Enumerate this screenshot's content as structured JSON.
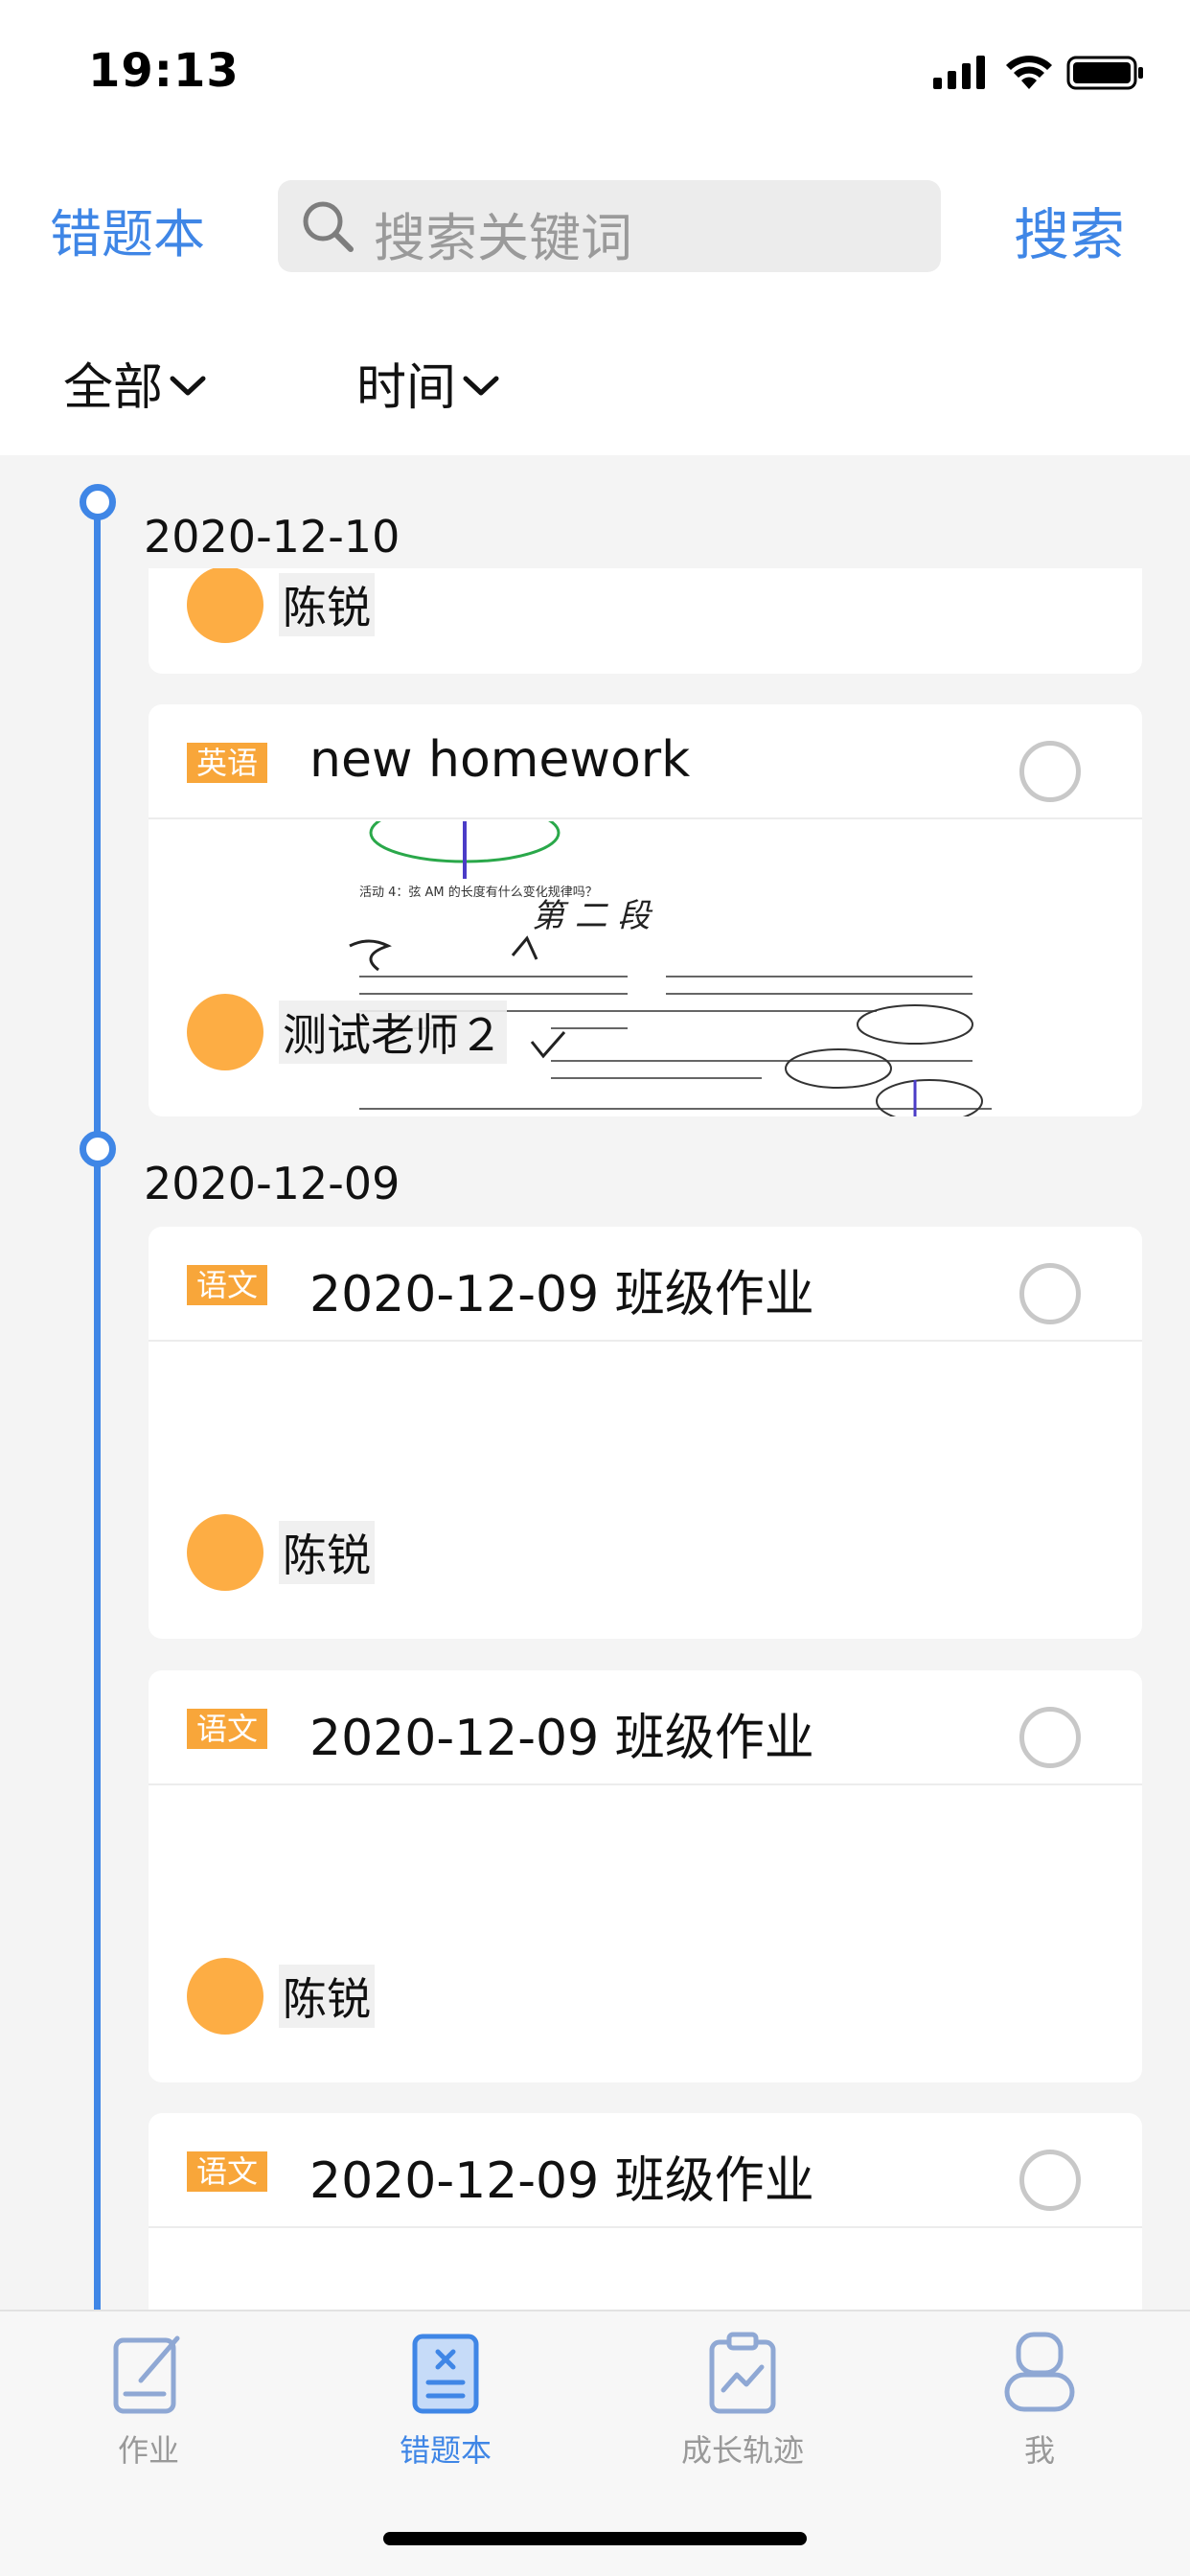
{
  "status_bar": {
    "time": "19:13"
  },
  "header": {
    "title": "错题本",
    "search": {
      "placeholder": "搜索关键词"
    },
    "search_button": "搜索"
  },
  "filters": [
    {
      "label": "全部"
    },
    {
      "label": "时间"
    }
  ],
  "groups": [
    {
      "date": "2020-12-10",
      "items": [
        {
          "subject": "",
          "title": "",
          "author": "陈锐"
        },
        {
          "subject": "英语",
          "title": "new homework",
          "author": "测试老师２"
        }
      ]
    },
    {
      "date": "2020-12-09",
      "items": [
        {
          "subject": "语文",
          "title": "2020-12-09 班级作业",
          "author": "陈锐"
        },
        {
          "subject": "语文",
          "title": "2020-12-09 班级作业",
          "author": "陈锐"
        },
        {
          "subject": "语文",
          "title": "2020-12-09 班级作业",
          "author": ""
        }
      ]
    }
  ],
  "tabbar": {
    "items": [
      {
        "label": "作业",
        "icon": "homework-icon"
      },
      {
        "label": "错题本",
        "icon": "mistake-book-icon"
      },
      {
        "label": "成长轨迹",
        "icon": "growth-chart-icon"
      },
      {
        "label": "我",
        "icon": "profile-icon"
      }
    ],
    "active": "错题本"
  },
  "colors": {
    "accent": "#3f86e6",
    "tag": "#f8a63a",
    "avatar": "#fdad44"
  }
}
